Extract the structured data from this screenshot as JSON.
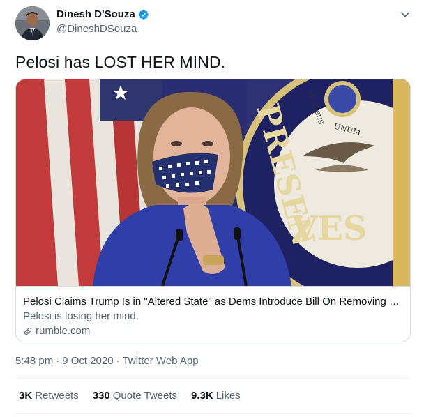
{
  "author": {
    "display_name": "Dinesh D'Souza",
    "handle": "@DineshDSouza",
    "verified": true
  },
  "tweet": {
    "text": "Pelosi has LOST HER MIND."
  },
  "card": {
    "title": "Pelosi Claims Trump Is in \"Altered State\" as Dems Introduce Bill On Removing Pre...",
    "description": "Pelosi is losing her mind.",
    "domain": "rumble.com",
    "image_text": {
      "seal_large": "PRESEN",
      "seal_bottom": "VES",
      "seal_small": "UNUM",
      "seal_top": "PLURIBUS"
    }
  },
  "meta": {
    "time": "5:48 pm",
    "separator_1": "·",
    "date": "9 Oct 2020",
    "separator_2": "·",
    "source": "Twitter Web App"
  },
  "stats": [
    {
      "count": "3K",
      "label": "Retweets"
    },
    {
      "count": "330",
      "label": "Quote Tweets"
    },
    {
      "count": "9.3K",
      "label": "Likes"
    }
  ],
  "colors": {
    "verified_blue": "#1d9bf0",
    "secondary_text": "#536471",
    "primary_text": "#0f1419",
    "border": "#cfd9de"
  },
  "icons": [
    "verified-badge-icon",
    "chevron-down-icon",
    "link-icon"
  ]
}
